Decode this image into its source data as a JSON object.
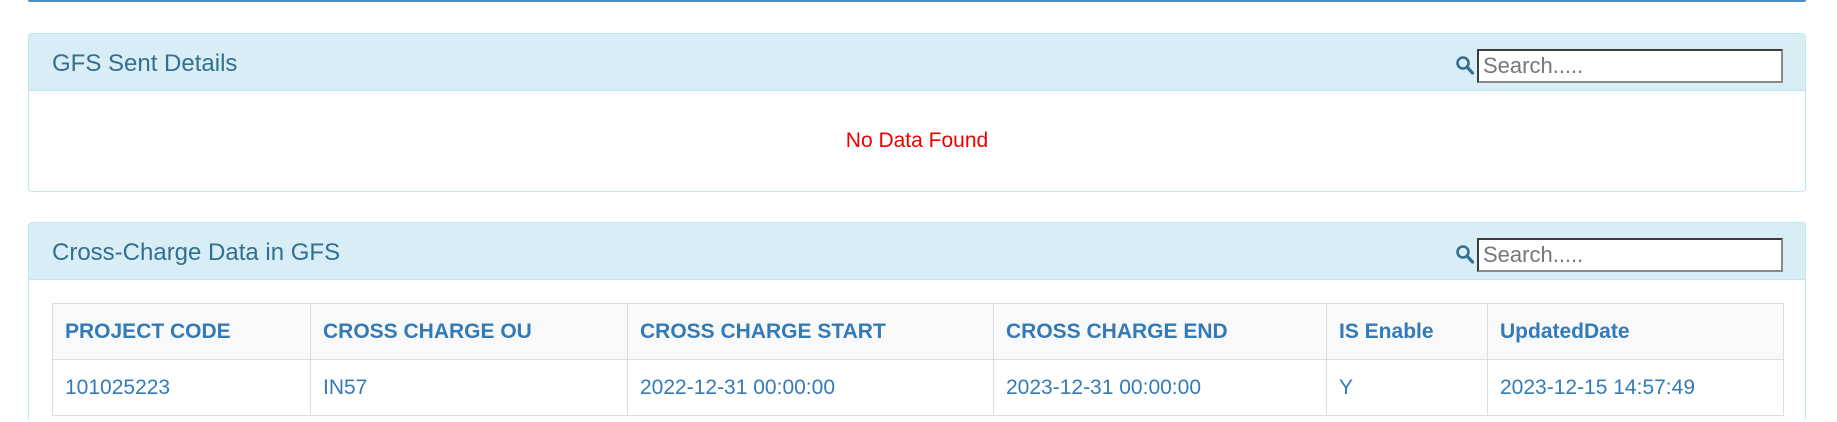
{
  "panels": {
    "gfs_sent": {
      "title": "GFS Sent Details",
      "search_placeholder": "Search.....",
      "empty_message": "No Data Found"
    },
    "cross_charge": {
      "title": "Cross-Charge Data in GFS",
      "search_placeholder": "Search.....",
      "columns": [
        "PROJECT CODE",
        "CROSS CHARGE OU",
        "CROSS CHARGE START",
        "CROSS CHARGE END",
        "IS Enable",
        "UpdatedDate"
      ],
      "rows": [
        [
          "101025223",
          "IN57",
          "2022-12-31 00:00:00",
          "2023-12-31 00:00:00",
          "Y",
          "2023-12-15 14:57:49"
        ]
      ]
    }
  },
  "icons": {
    "search": "search-icon"
  },
  "colors": {
    "heading_bg": "#d9edf7",
    "heading_text": "#31708f",
    "table_text": "#337ab7",
    "empty_text": "#ee0000"
  }
}
